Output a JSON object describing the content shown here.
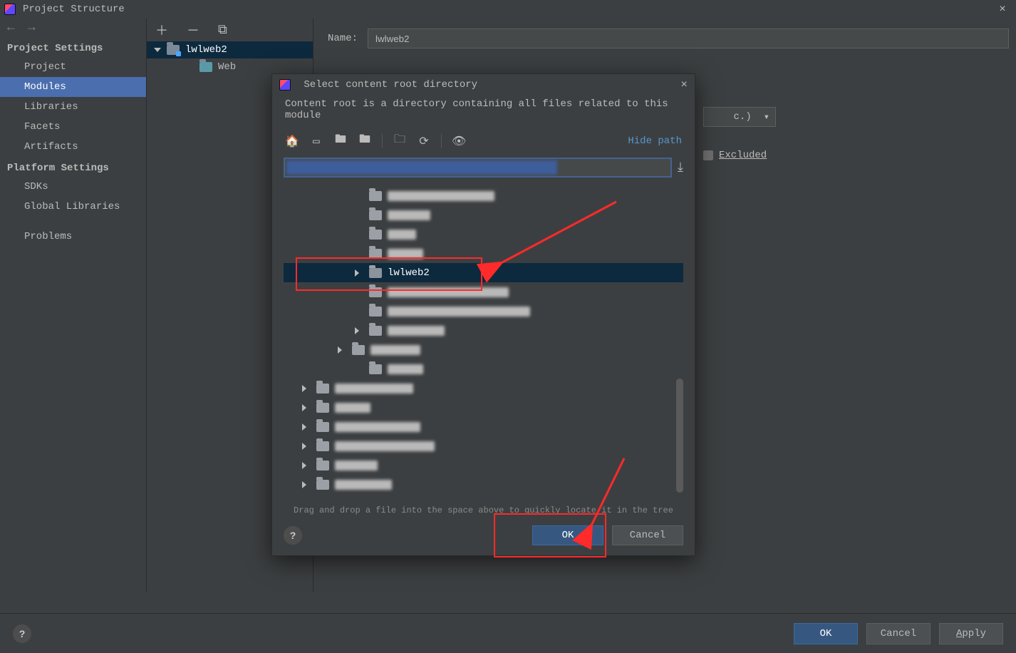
{
  "window": {
    "title": "Project Structure"
  },
  "sidebar": {
    "section1": "Project Settings",
    "items1": [
      "Project",
      "Modules",
      "Libraries",
      "Facets",
      "Artifacts"
    ],
    "section2": "Platform Settings",
    "items2": [
      "SDKs",
      "Global Libraries"
    ],
    "problems": "Problems"
  },
  "moduleTree": {
    "root": "lwlweb2",
    "child": "Web"
  },
  "main": {
    "name_label": "Name:",
    "name_value": "lwlweb2",
    "dropdown_tail": "c.)",
    "excluded": "Excluded"
  },
  "dialog": {
    "title": "Select content root directory",
    "desc": "Content root is a directory containing all files related to this module",
    "hide_path": "Hide path",
    "selected_folder": "lwlweb2",
    "hint": "Drag and drop a file into the space above to quickly locate it in the tree",
    "ok": "OK",
    "cancel": "Cancel"
  },
  "bottom": {
    "ok": "OK",
    "cancel": "Cancel",
    "apply": "Apply"
  }
}
